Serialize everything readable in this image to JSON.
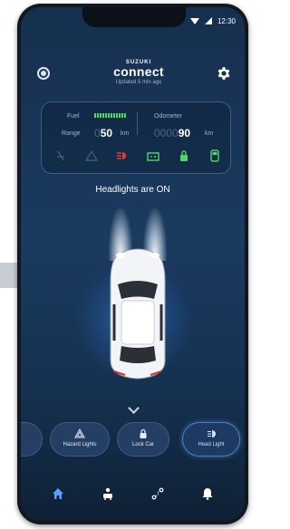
{
  "status_bar": {
    "time": "12:30"
  },
  "header": {
    "brand_top": "SUZUKI",
    "brand_name": "connect",
    "updated": "Updated 5 min ago"
  },
  "vehicle": {
    "fuel_label": "Fuel",
    "range_label": "Range",
    "range_ghost": "0",
    "range_value": "50",
    "range_unit": "km",
    "odometer_label": "Odometer",
    "odometer_ghost": "0000",
    "odometer_value": "90",
    "odometer_unit": "km",
    "fuel_level": 1.0
  },
  "indicators": [
    {
      "icon": "seatbelt-icon",
      "color": "#3b5a7c"
    },
    {
      "icon": "warning-triangle-icon",
      "color": "#3b5a7c"
    },
    {
      "icon": "headlight-icon",
      "color": "#e63b3b"
    },
    {
      "icon": "battery-icon",
      "color": "#4cd964"
    },
    {
      "icon": "lock-icon",
      "color": "#4cd964"
    },
    {
      "icon": "door-icon",
      "color": "#4cd964"
    }
  ],
  "headline": "Headlights are ON",
  "quick_actions": [
    {
      "label": "Hazard Lights",
      "icon": "hazard-icon"
    },
    {
      "label": "Lock Car",
      "icon": "lock-icon"
    },
    {
      "label": "Head Light",
      "icon": "headlight-icon"
    }
  ],
  "nav": [
    "home-icon",
    "driver-icon",
    "route-icon",
    "bell-icon"
  ],
  "colors": {
    "accent": "#4f7fc0",
    "ok": "#4cd964",
    "alert": "#e63b3b",
    "background": "#1a3a5f"
  }
}
